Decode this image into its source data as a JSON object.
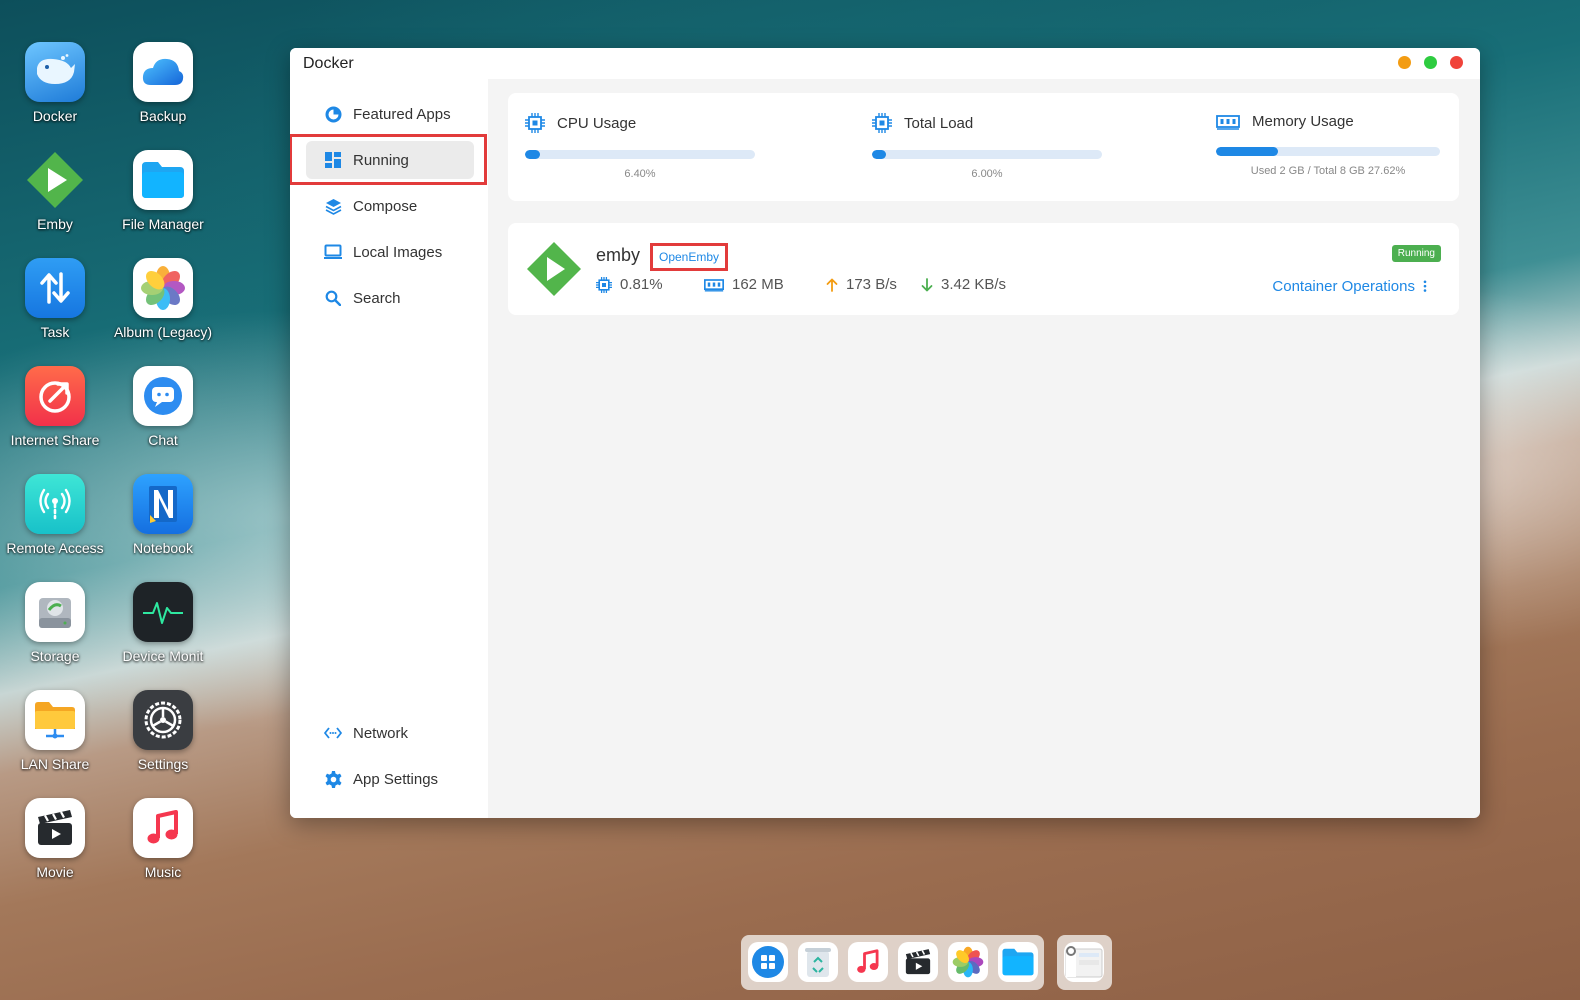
{
  "desktop": {
    "icons": [
      {
        "label": "Docker"
      },
      {
        "label": "Backup"
      },
      {
        "label": "Emby"
      },
      {
        "label": "File Manager"
      },
      {
        "label": "Task"
      },
      {
        "label": "Album (Legacy)"
      },
      {
        "label": "Internet Share"
      },
      {
        "label": "Chat"
      },
      {
        "label": "Remote Access"
      },
      {
        "label": "Notebook"
      },
      {
        "label": "Storage"
      },
      {
        "label": "Device Monit"
      },
      {
        "label": "LAN Share"
      },
      {
        "label": "Settings"
      },
      {
        "label": "Movie"
      },
      {
        "label": "Music"
      }
    ]
  },
  "window": {
    "title": "Docker",
    "controls": {
      "minimize_color": "#f39c12",
      "maximize_color": "#2ecc40",
      "close_color": "#f0433a"
    }
  },
  "sidebar": {
    "items": [
      {
        "label": "Featured Apps",
        "icon": "featured-icon"
      },
      {
        "label": "Running",
        "icon": "grid-icon",
        "active": true
      },
      {
        "label": "Compose",
        "icon": "layers-icon"
      },
      {
        "label": "Local Images",
        "icon": "monitor-icon"
      },
      {
        "label": "Search",
        "icon": "search-icon"
      }
    ],
    "bottom_items": [
      {
        "label": "Network",
        "icon": "network-icon"
      },
      {
        "label": "App Settings",
        "icon": "gear-icon"
      }
    ]
  },
  "stats": {
    "cpu": {
      "label": "CPU Usage",
      "value_text": "6.40%",
      "fraction": 0.064
    },
    "load": {
      "label": "Total Load",
      "value_text": "6.00%",
      "fraction": 0.06
    },
    "memory": {
      "label": "Memory Usage",
      "value_text": "Used 2 GB / Total 8 GB  27.62%",
      "fraction": 0.2762
    }
  },
  "container": {
    "name": "emby",
    "open_link": "OpenEmby",
    "status": "Running",
    "cpu": "0.81%",
    "memory": "162 MB",
    "upload": "173 B/s",
    "download": "3.42 KB/s",
    "operations": "Container Operations"
  },
  "colors": {
    "accent": "#1e88e5",
    "running": "#4caf50",
    "highlight": "#e23b3b",
    "emby_green": "#52b54b"
  }
}
